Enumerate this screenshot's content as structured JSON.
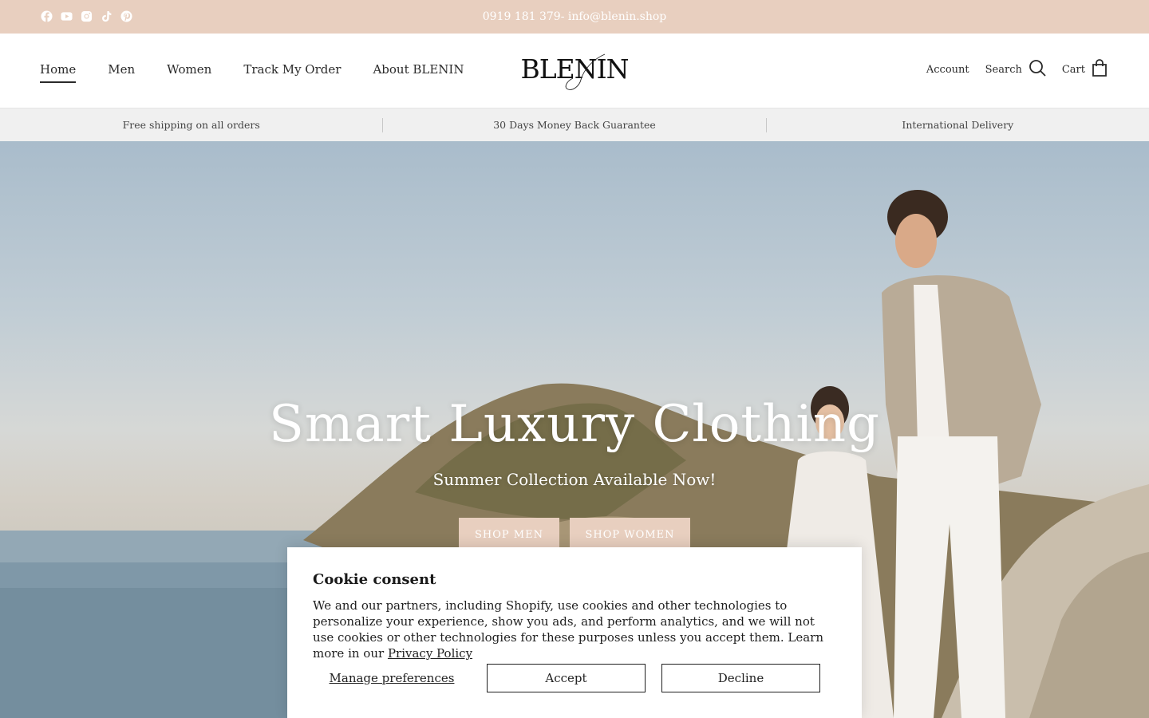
{
  "announcement": {
    "contact": "0919 181 379- info@blenin.shop",
    "social_icons": [
      "facebook-icon",
      "youtube-icon",
      "instagram-icon",
      "tiktok-icon",
      "pinterest-icon"
    ]
  },
  "header": {
    "nav": [
      {
        "label": "Home",
        "active": true
      },
      {
        "label": "Men"
      },
      {
        "label": "Women"
      },
      {
        "label": "Track My Order"
      },
      {
        "label": "About BLENIN"
      }
    ],
    "logo": "BLENIN",
    "account_label": "Account",
    "search_label": "Search",
    "cart_label": "Cart"
  },
  "usp": {
    "items": [
      "Free shipping on all orders",
      "30 Days Money Back Guarantee",
      "International Delivery"
    ]
  },
  "hero": {
    "title": "Smart Luxury Clothing",
    "subtitle": "Summer Collection Available Now!",
    "btn_men": "SHOP MEN",
    "btn_women": "SHOP WOMEN"
  },
  "cookie": {
    "title": "Cookie consent",
    "text": "We and our partners, including Shopify, use cookies and other technologies to personalize your experience, show you ads, and perform analytics, and we will not use cookies or other technologies for these purposes unless you accept them. Learn more in our ",
    "link": "Privacy Policy",
    "manage": "Manage preferences",
    "accept": "Accept",
    "decline": "Decline"
  },
  "colors": {
    "accent": "#e8cfbf",
    "usp_bg": "#f0f0f0",
    "text": "#1f1f1f"
  }
}
